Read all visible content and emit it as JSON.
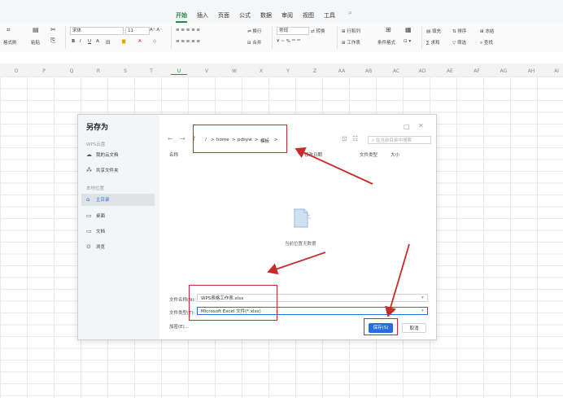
{
  "ribbon": {
    "tabs": [
      "开始",
      "插入",
      "页面",
      "公式",
      "数据",
      "审阅",
      "视图",
      "工具"
    ],
    "active_tab": "开始"
  },
  "toolbar": {
    "format_painter": "格式刷",
    "paste": "粘贴",
    "font_name": "宋体",
    "font_size": "11",
    "wrap": "换行",
    "merge": "合并",
    "number_format": "常规",
    "convert": "转换",
    "row_col": "行和列",
    "worksheet": "工作表",
    "cond_format": "条件格式",
    "fill": "填充",
    "sort": "排序",
    "freeze": "冻结",
    "sum": "求和",
    "filter": "筛选",
    "find": "查找"
  },
  "columns": [
    "O",
    "P",
    "Q",
    "R",
    "S",
    "T",
    "U",
    "V",
    "W",
    "X",
    "Y",
    "Z",
    "AA",
    "AB",
    "AC",
    "AD",
    "AE",
    "AF",
    "AG",
    "AH",
    "AI"
  ],
  "dialog": {
    "title": "另存为",
    "sidebar": {
      "cloud_section": "WPS云盘",
      "my_cloud": "我的云文档",
      "shared": "共享文件夹",
      "local_section": "本地位置",
      "home": "主目录",
      "desktop": "桌面",
      "documents": "文档",
      "browse": "浏览"
    },
    "breadcrumb": [
      "/",
      "home",
      "pdsyw",
      "模板"
    ],
    "search_placeholder": "在当前目录中搜索",
    "col_name": "名称",
    "col_modified": "修改日期",
    "col_type": "文件类型",
    "col_size": "大小",
    "empty_text": "当前位置无数据",
    "filename_label": "文件名称(N):",
    "filename_value": "WPS表格工作表.xlsx",
    "filetype_label": "文件类型(T):",
    "filetype_value": "Microsoft Excel 文件(*.xlsx)",
    "encrypt_label": "加密(E)...",
    "save_label": "保存(S)",
    "cancel_label": "取消"
  },
  "colors": {
    "accent_green": "#1e8b4a",
    "primary_blue": "#2a6de0",
    "annotation_red": "#c92a2a"
  }
}
